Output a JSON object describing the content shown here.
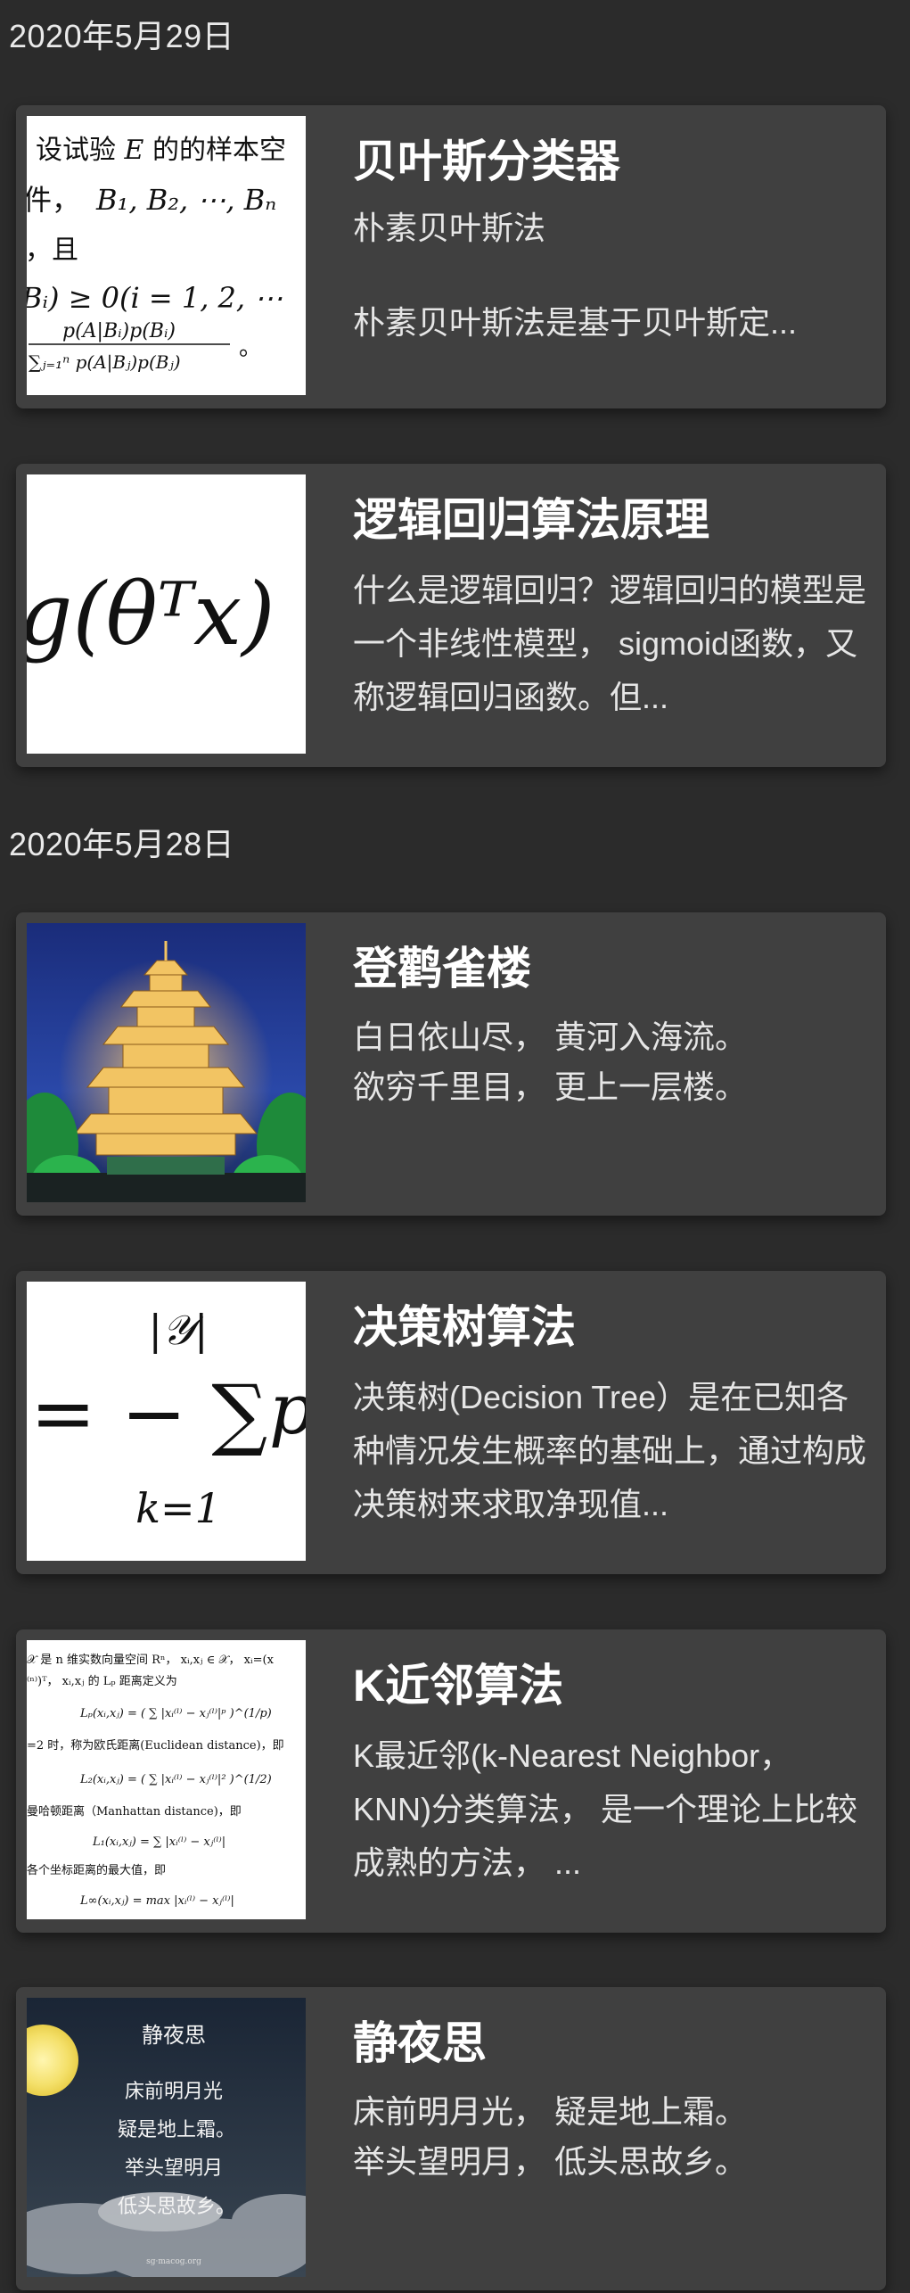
{
  "sections": [
    {
      "date": "2020年5月29日",
      "cards": [
        {
          "title": "贝叶斯分类器",
          "subtitle": "朴素贝叶斯法",
          "summary": "朴素贝叶斯法是基于贝叶斯定...",
          "thumb_icon": "bayes-formula-thumbnail",
          "thumb_text": {
            "l1": "设试验",
            "l1_var": "E",
            "l1_tail": "的的样本空",
            "l2": "件，",
            "l2_math": "B₁, B₂, ⋯, Bₙ",
            "l3": "，且",
            "l4": "Bᵢ) ≥ 0(i = 1, 2, ⋯",
            "l5_num": "p(A|Bᵢ)p(Bᵢ)",
            "l5_den": "∑ⱼ₌₁ⁿ p(A|Bⱼ)p(Bⱼ)",
            "l5_tail": "。"
          }
        },
        {
          "title": "逻辑回归算法原理",
          "summary": "什么是逻辑回归？逻辑回归的模型是一个非线性模型， sigmoid函数，又称逻辑回归函数。但...",
          "thumb_icon": "sigmoid-formula-thumbnail",
          "thumb_text": {
            "formula": "g(θᵀx) ="
          }
        }
      ]
    },
    {
      "date": "2020年5月28日",
      "cards": [
        {
          "title": "登鹳雀楼",
          "summary_lines": [
            "白日依山尽， 黄河入海流。",
            "欲穷千里目， 更上一层楼。"
          ],
          "thumb_icon": "pavilion-night-photo"
        },
        {
          "title": "决策树算法",
          "summary": "决策树(Decision Tree）是在已知各种情况发生概率的基础上，通过构成决策树来求取净现值...",
          "thumb_icon": "entropy-formula-thumbnail",
          "thumb_text": {
            "top": "|𝒴|",
            "mid": "= − ∑",
            "tail": "p",
            "bottom": "k=1"
          }
        },
        {
          "title": "K近邻算法",
          "summary": "K最近邻(k-Nearest Neighbor， KNN)分类算法， 是一个理论上比较成熟的方法， ...",
          "thumb_icon": "distance-formula-thumbnail",
          "thumb_text": {
            "t1": "𝒳 是 n 维实数向量空间 Rⁿ， xᵢ,xⱼ ∈ 𝒳， xᵢ=(x",
            "t2": "⁽ⁿ⁾)ᵀ， xᵢ,xⱼ 的 Lₚ 距离定义为",
            "t3": "Lₚ(xᵢ,xⱼ) = ( ∑ |xᵢ⁽ˡ⁾ − xⱼ⁽ˡ⁾|ᵖ )^(1/p)",
            "t4": "=2 时，称为欧氏距离(Euclidean distance)，即",
            "t5": "L₂(xᵢ,xⱼ) = ( ∑ |xᵢ⁽ˡ⁾ − xⱼ⁽ˡ⁾|² )^(1/2)",
            "t6": "曼哈顿距离（Manhattan distance)，即",
            "t7": "L₁(xᵢ,xⱼ) = ∑ |xᵢ⁽ˡ⁾ − xⱼ⁽ˡ⁾|",
            "t8": "各个坐标距离的最大值，即",
            "t9": "L∞(xᵢ,xⱼ) = max |xᵢ⁽ˡ⁾ − xⱼ⁽ˡ⁾|"
          }
        },
        {
          "title": "静夜思",
          "summary_lines": [
            "床前明月光， 疑是地上霜。",
            "举头望明月， 低头思故乡。"
          ],
          "thumb_icon": "moon-poem-image",
          "thumb_text": {
            "poem_title": "静夜思",
            "p1": "床前明月光",
            "p2": "疑是地上霜。",
            "p3": "举头望明月",
            "p4": "低头思故乡。",
            "credit": "sg·macog.org"
          }
        }
      ]
    }
  ],
  "colors": {
    "background": "#2b2b2b",
    "card": "#404040",
    "title": "#ffffff",
    "text": "#e6e6e6"
  }
}
